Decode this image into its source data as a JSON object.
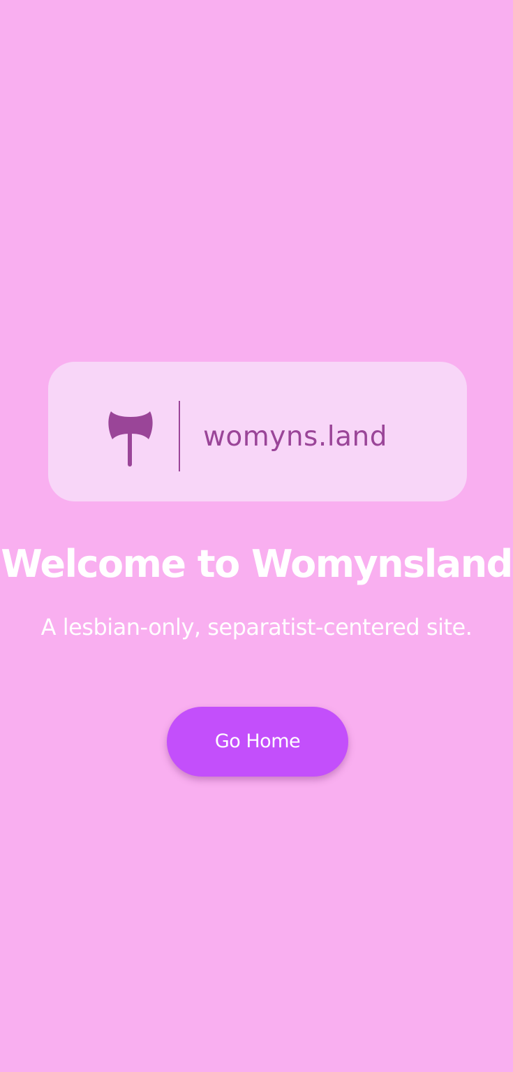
{
  "logo": {
    "icon": "labrys-icon",
    "text": "womyns.land",
    "color": "#9a4598"
  },
  "main": {
    "title": "Welcome to Womynsland",
    "subtitle": "A lesbian-only, separatist-centered site.",
    "button_label": "Go Home"
  },
  "colors": {
    "background": "#f9aff0",
    "card": "#f8d6f8",
    "button": "#c34ffb",
    "text": "#ffffff"
  }
}
